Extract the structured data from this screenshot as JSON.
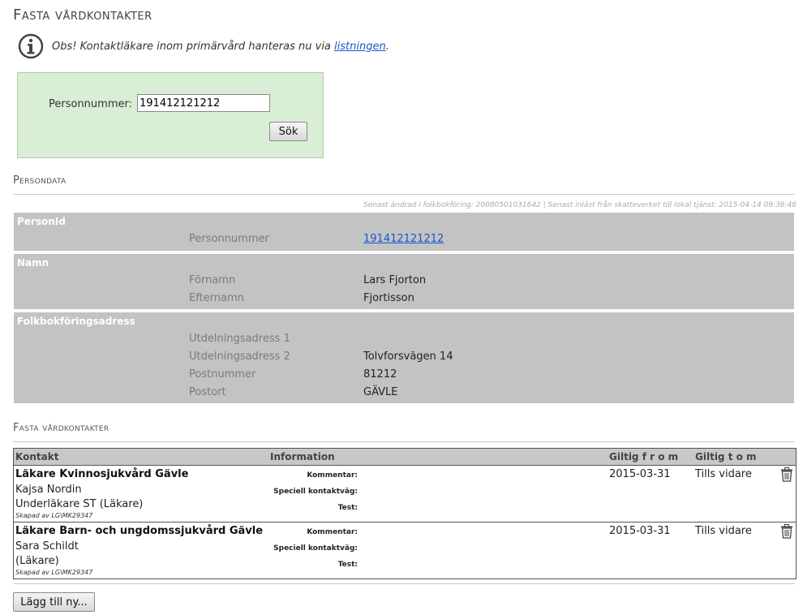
{
  "page": {
    "title": "Fasta vårdkontakter"
  },
  "notice": {
    "icon": "info-icon",
    "text_before": "Obs! Kontaktläkare inom primärvård hanteras nu via ",
    "link": "listningen",
    "text_after": "."
  },
  "search": {
    "label": "Personnummer:",
    "value": "191412121212",
    "button": "Sök"
  },
  "persondata": {
    "section_title": "Persondata",
    "meta": "Senast ändrad i folkbokföring: 20080501031642 | Senast inläst från skatteverket till lokal tjänst: 2015-04-14 09:36:46",
    "groups": [
      {
        "title": "PersonId",
        "rows": [
          {
            "label": "Personnummer",
            "value": "191412121212"
          }
        ]
      },
      {
        "title": "Namn",
        "rows": [
          {
            "label": "Förnamn",
            "value": "Lars Fjorton"
          },
          {
            "label": "Efternamn",
            "value": "Fjortisson"
          }
        ]
      },
      {
        "title": "Folkbokföringsadress",
        "rows": [
          {
            "label": "Utdelningsadress 1",
            "value": ""
          },
          {
            "label": "Utdelningsadress 2",
            "value": "Tolvforsvägen 14"
          },
          {
            "label": "Postnummer",
            "value": "81212"
          },
          {
            "label": "Postort",
            "value": "GÄVLE"
          }
        ]
      }
    ]
  },
  "contacts": {
    "section_title": "Fasta vårdkontakter",
    "columns": [
      "Kontakt",
      "Information",
      "Giltig f r o m",
      "Giltig t o m"
    ],
    "info_labels": [
      "Kommentar:",
      "Speciell kontaktväg:",
      "Test:"
    ],
    "rows": [
      {
        "unit": "Läkare Kvinnosjukvård Gävle",
        "person": "Kajsa Nordin",
        "role": "Underläkare ST (Läkare)",
        "created": "Skapad av LG\\MK29347",
        "from": "2015-03-31",
        "tom": "Tills vidare"
      },
      {
        "unit": "Läkare Barn- och ungdomssjukvård Gävle",
        "person": "Sara Schildt",
        "role": "(Läkare)",
        "created": "Skapad av LG\\MK29347",
        "from": "2015-03-31",
        "tom": "Tills vidare"
      }
    ],
    "add_button": "Lägg till ny..."
  }
}
